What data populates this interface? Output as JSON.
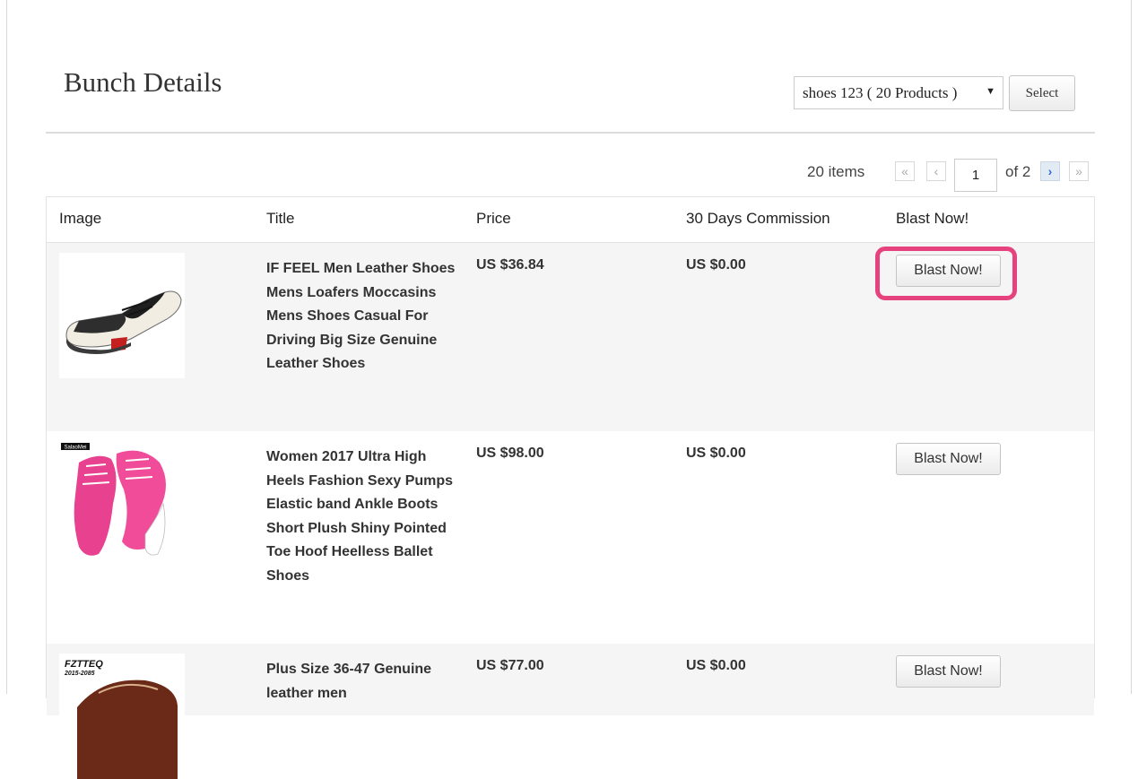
{
  "page": {
    "title": "Bunch Details"
  },
  "bunch_selector": {
    "selected": "shoes 123 ( 20 Products )",
    "select_label": "Select"
  },
  "pagination": {
    "items_count": "20 items",
    "first": "«",
    "prev": "‹",
    "current_page": "1",
    "of_label": "of 2",
    "next": "›",
    "last": "»"
  },
  "table": {
    "headers": [
      "Image",
      "Title",
      "Price",
      "30 Days Commission",
      "Blast Now!"
    ],
    "rows": [
      {
        "title": "IF FEEL Men Leather Shoes Mens Loafers Moccasins Mens Shoes Casual For Driving Big Size Genuine Leather Shoes",
        "price": "US $36.84",
        "commission": "US $0.00",
        "action": "Blast Now!",
        "image_icon": "loafer-shoe-image"
      },
      {
        "title": "Women 2017 Ultra High Heels Fashion Sexy Pumps Elastic band Ankle Boots Short Plush Shiny Pointed Toe Hoof Heelless Ballet Shoes",
        "price": "US $98.00",
        "commission": "US $0.00",
        "action": "Blast Now!",
        "image_icon": "pink-heelless-boot-image",
        "image_logo_text": "SalaoMei"
      },
      {
        "title": "Plus Size 36-47 Genuine leather men",
        "price": "US $77.00",
        "commission": "US $0.00",
        "action": "Blast Now!",
        "image_icon": "brown-boat-shoe-image",
        "image_logo_text": "FZTTEQ",
        "image_logo_subtext": "2015-2085"
      }
    ]
  },
  "colors": {
    "highlight": "#e6437e",
    "active_page_button": "#e2eaf4",
    "row_alt": "#f5f5f5"
  }
}
